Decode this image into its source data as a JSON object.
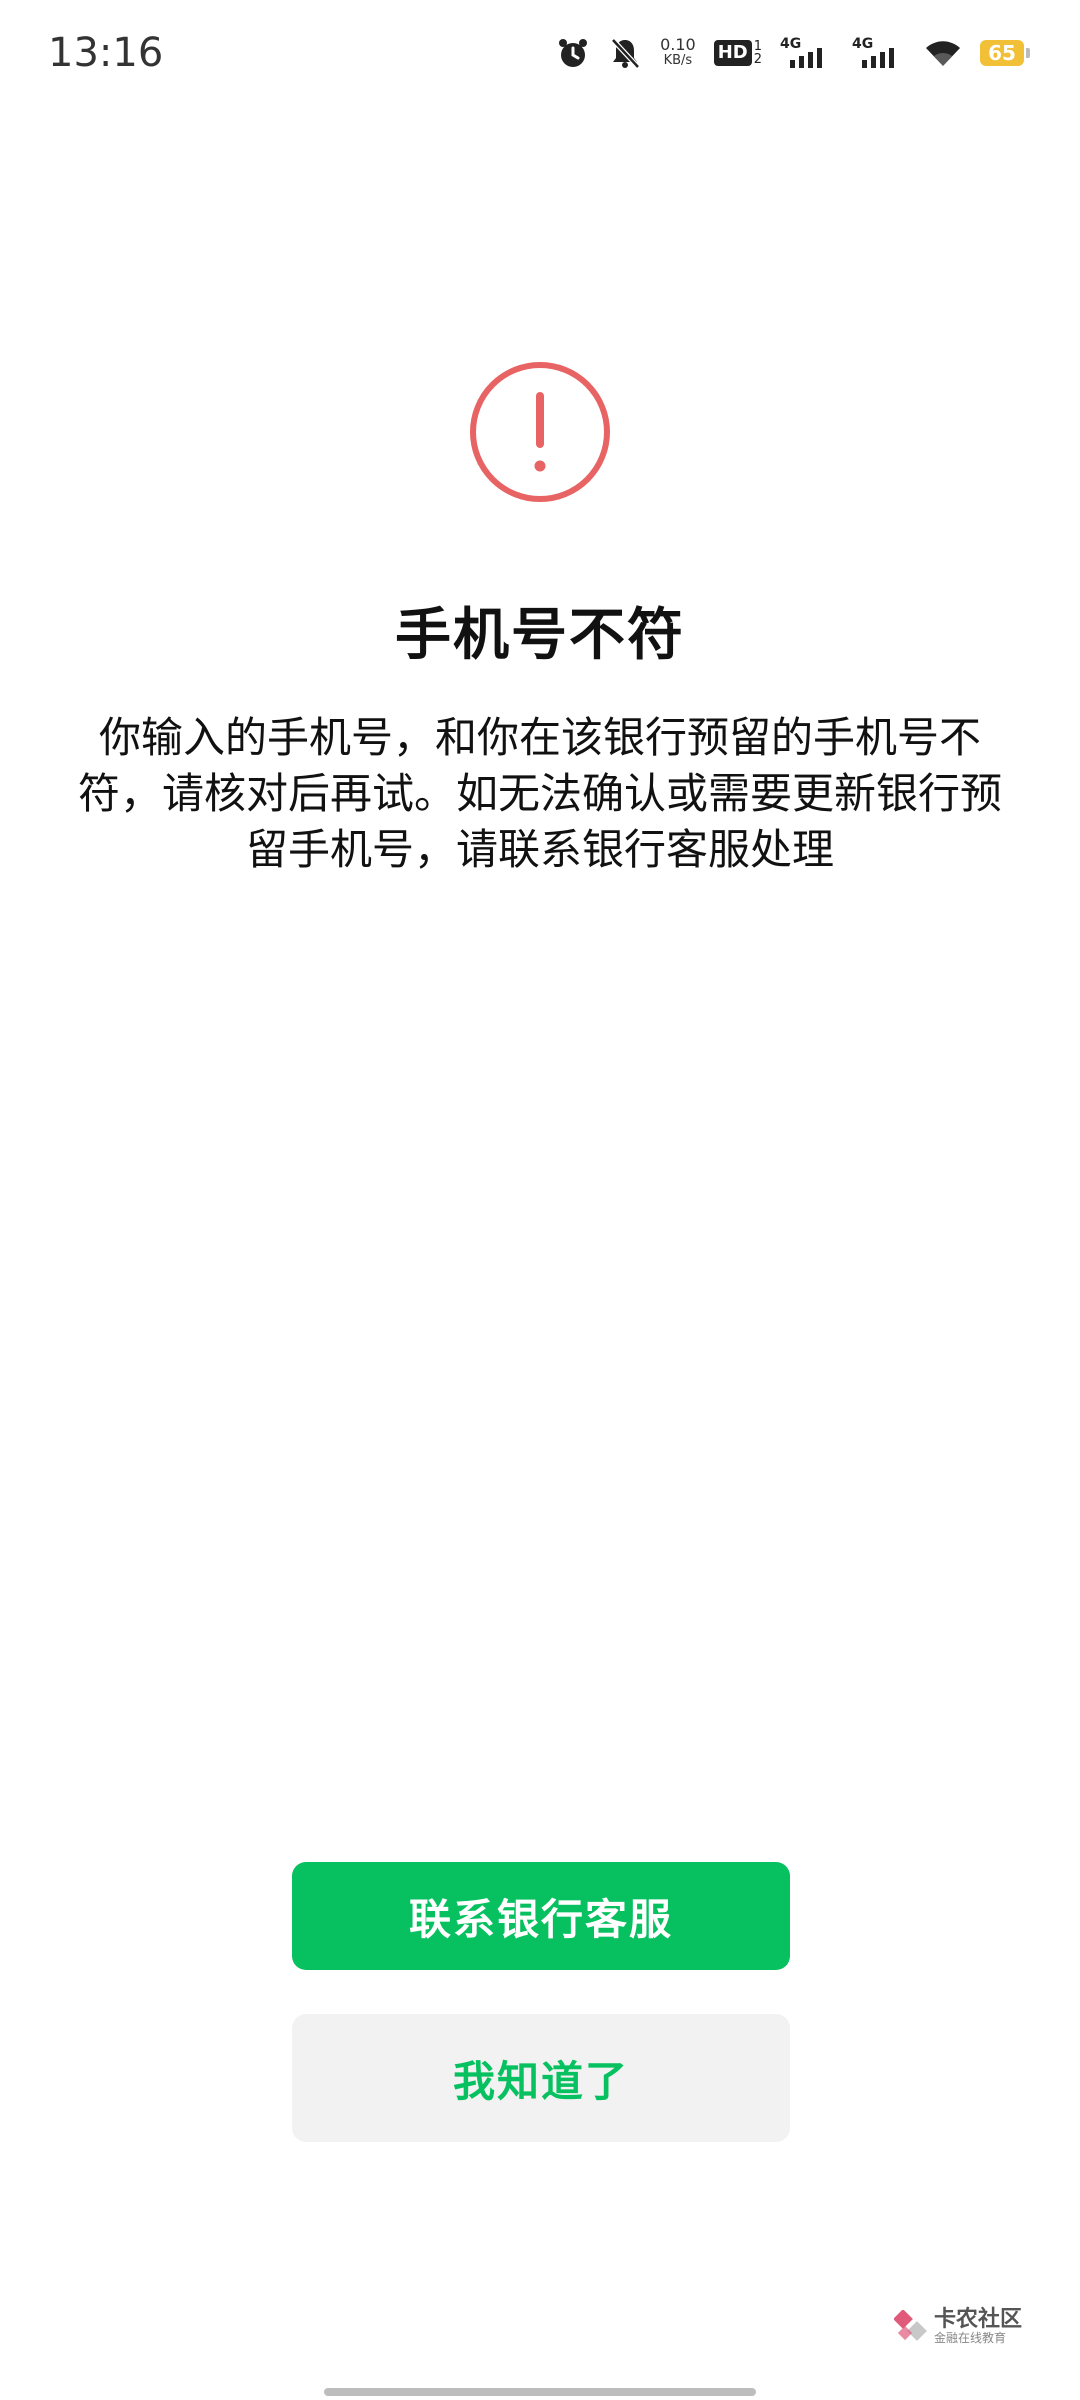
{
  "status_bar": {
    "time": "13:16",
    "net_speed_value": "0.10",
    "net_speed_unit": "KB/s",
    "hd_label": "HD",
    "hd_sub_top": "1",
    "hd_sub_bottom": "2",
    "signal_1_label": "4G",
    "signal_2_label": "4G",
    "battery_level": "65"
  },
  "alert": {
    "icon": "exclamation-circle-icon",
    "icon_color": "#e86464",
    "title": "手机号不符",
    "message": "你输入的手机号，和你在该银行预留的手机号不符，请核对后再试。如无法确认或需要更新银行预留手机号，请联系银行客服处理"
  },
  "actions": {
    "contact_label": "联系银行客服",
    "ok_label": "我知道了",
    "primary_color": "#07c160"
  },
  "watermark": {
    "main": "卡农社区",
    "sub": "金融在线教育"
  }
}
